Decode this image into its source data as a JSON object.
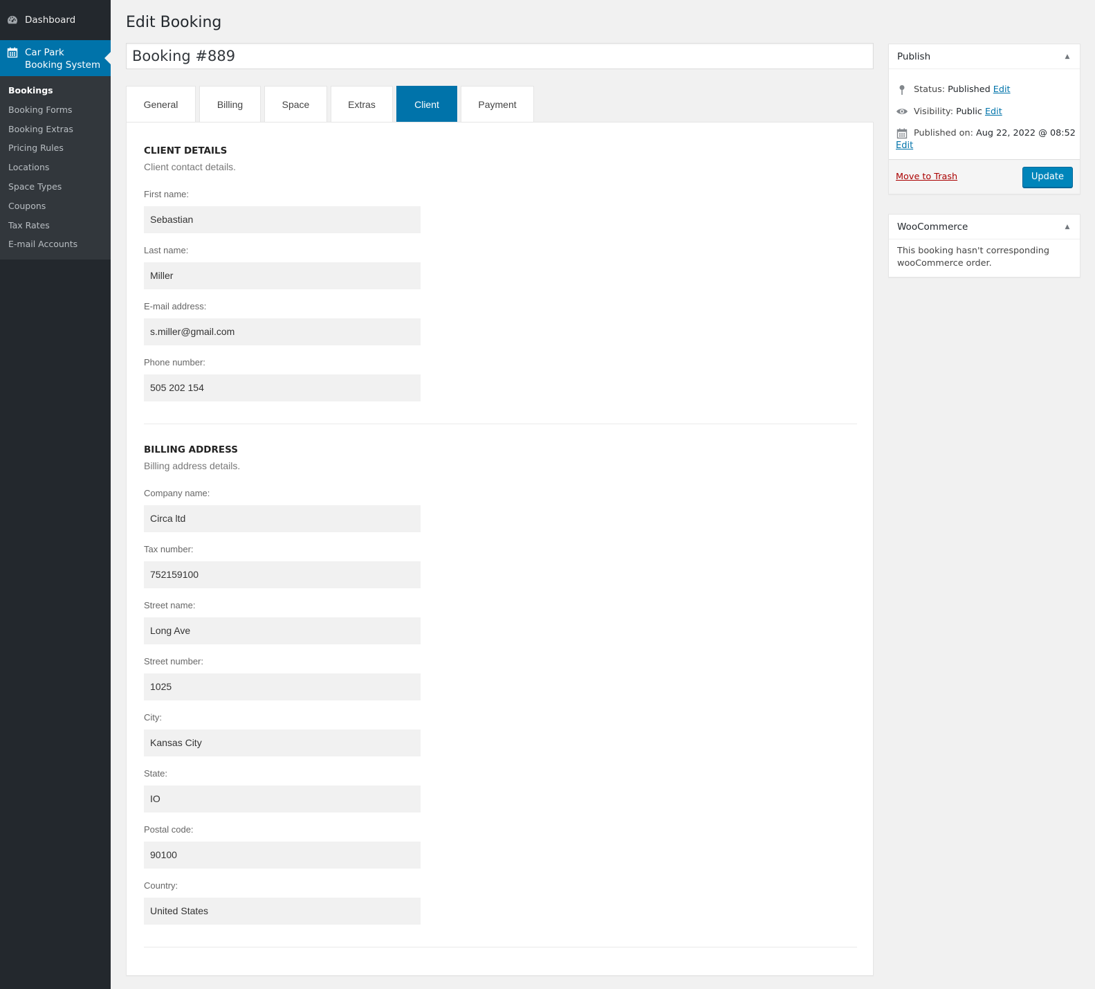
{
  "sidebar": {
    "dashboard_label": "Dashboard",
    "current_menu": {
      "line1": "Car Park",
      "line2": "Booking System"
    },
    "submenu": [
      "Bookings",
      "Booking Forms",
      "Booking Extras",
      "Pricing Rules",
      "Locations",
      "Space Types",
      "Coupons",
      "Tax Rates",
      "E-mail Accounts"
    ]
  },
  "page": {
    "title": "Edit Booking",
    "booking_title": "Booking #889"
  },
  "tabs": [
    "General",
    "Billing",
    "Space",
    "Extras",
    "Client",
    "Payment"
  ],
  "active_tab": "Client",
  "client_details": {
    "title": "CLIENT DETAILS",
    "description": "Client contact details.",
    "fields": [
      {
        "label": "First name:",
        "value": "Sebastian"
      },
      {
        "label": "Last name:",
        "value": "Miller"
      },
      {
        "label": "E-mail address:",
        "value": "s.miller@gmail.com"
      },
      {
        "label": "Phone number:",
        "value": "505 202 154"
      }
    ]
  },
  "billing_address": {
    "title": "BILLING ADDRESS",
    "description": "Billing address details.",
    "fields": [
      {
        "label": "Company name:",
        "value": "Circa ltd"
      },
      {
        "label": "Tax number:",
        "value": "752159100"
      },
      {
        "label": "Street name:",
        "value": "Long Ave"
      },
      {
        "label": "Street number:",
        "value": "1025"
      },
      {
        "label": "City:",
        "value": "Kansas City"
      },
      {
        "label": "State:",
        "value": "IO"
      },
      {
        "label": "Postal code:",
        "value": "90100"
      },
      {
        "label": "Country:",
        "value": "United States"
      }
    ]
  },
  "publish": {
    "title": "Publish",
    "status_label": "Status:",
    "status_value": "Published",
    "visibility_label": "Visibility:",
    "visibility_value": "Public",
    "published_label": "Published on:",
    "published_value": "Aug 22, 2022 @ 08:52",
    "edit_link": "Edit",
    "trash_label": "Move to Trash",
    "update_label": "Update"
  },
  "woocommerce": {
    "title": "WooCommerce",
    "message": "This booking hasn't corresponding wooCommerce order."
  },
  "icons": {
    "dashboard": "dashboard-icon",
    "car_park": "calendar-icon",
    "status": "pin-icon",
    "visibility": "eye-icon",
    "published": "calendar-icon",
    "toggle": "triangle-up-icon"
  },
  "colors": {
    "sidebar_bg": "#23282d",
    "submenu_bg": "#32373c",
    "accent": "#0073aa",
    "button": "#0085ba",
    "trash": "#aa0000"
  }
}
